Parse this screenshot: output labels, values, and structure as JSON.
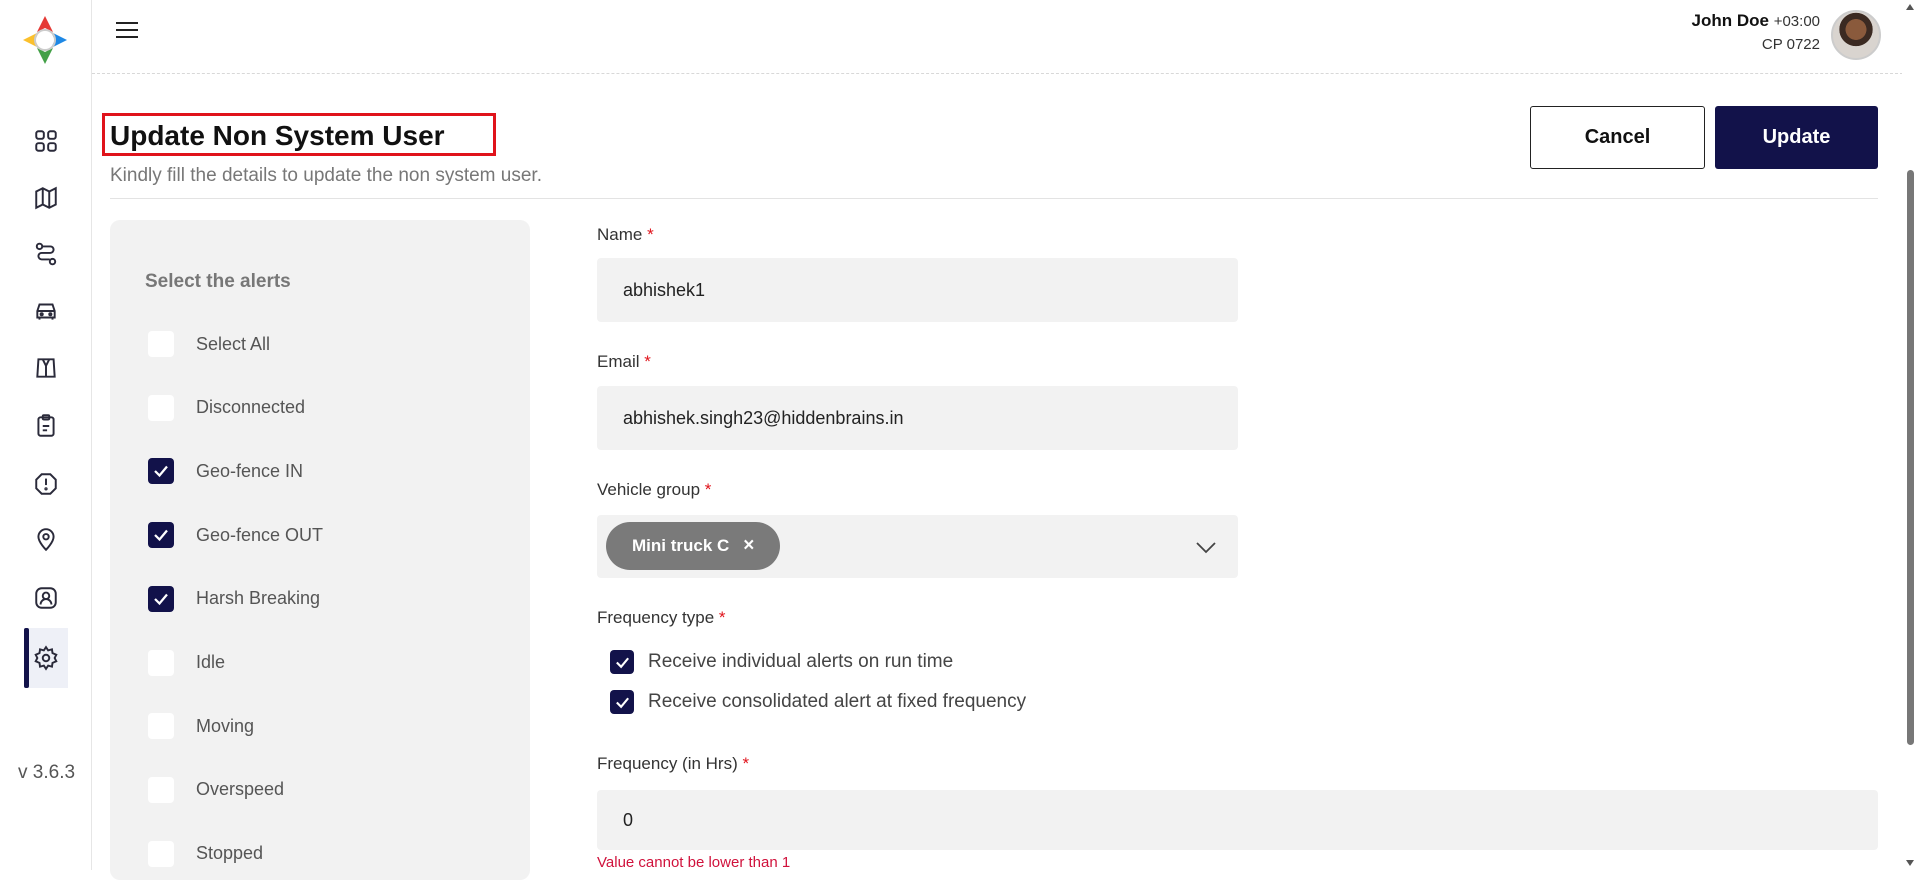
{
  "app": {
    "version": "v 3.6.3"
  },
  "user": {
    "name": "John Doe",
    "timezone": "+03:00",
    "code": "CP 0722"
  },
  "sidebar": {
    "items": [
      {
        "name": "dashboard-icon"
      },
      {
        "name": "map-icon"
      },
      {
        "name": "route-icon"
      },
      {
        "name": "vehicle-icon"
      },
      {
        "name": "tire-icon"
      },
      {
        "name": "clipboard-icon"
      },
      {
        "name": "alert-icon"
      },
      {
        "name": "location-pin-icon"
      },
      {
        "name": "user-profile-icon"
      },
      {
        "name": "settings-icon",
        "active": true
      }
    ]
  },
  "header": {
    "title": "Update Non System User",
    "subtitle": "Kindly fill the details to update the non system user.",
    "cancel_label": "Cancel",
    "update_label": "Update"
  },
  "alerts": {
    "title": "Select the alerts",
    "items": [
      {
        "label": "Select All",
        "checked": false
      },
      {
        "label": "Disconnected",
        "checked": false
      },
      {
        "label": "Geo-fence IN",
        "checked": true
      },
      {
        "label": "Geo-fence OUT",
        "checked": true
      },
      {
        "label": "Harsh Breaking",
        "checked": true
      },
      {
        "label": "Idle",
        "checked": false
      },
      {
        "label": "Moving",
        "checked": false
      },
      {
        "label": "Overspeed",
        "checked": false
      },
      {
        "label": "Stopped",
        "checked": false
      }
    ]
  },
  "form": {
    "name_label": "Name",
    "name_value": "abhishek1",
    "email_label": "Email",
    "email_value": "abhishek.singh23@hiddenbrains.in",
    "vehicle_group_label": "Vehicle group",
    "vehicle_group_chip": "Mini truck C",
    "chip_remove": "×",
    "frequency_type_label": "Frequency type",
    "frequency_options": [
      {
        "label": "Receive individual alerts on run time",
        "checked": true
      },
      {
        "label": "Receive consolidated alert at fixed frequency",
        "checked": true
      }
    ],
    "frequency_label": "Frequency (in Hrs)",
    "frequency_value": "0",
    "frequency_error": "Value cannot be lower than 1",
    "required_mark": "*"
  },
  "colors": {
    "primary": "#12124a",
    "error": "#d0123c",
    "highlight": "#e0131b"
  }
}
